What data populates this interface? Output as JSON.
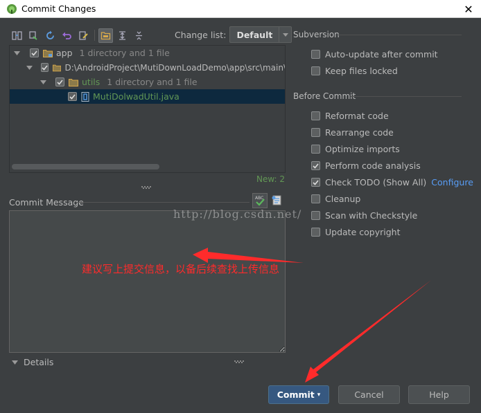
{
  "window": {
    "title": "Commit Changes"
  },
  "changelist": {
    "label": "Change list:",
    "value": "Default"
  },
  "tree": {
    "rows": [
      {
        "name": "app",
        "meta": "1 directory and 1 file"
      },
      {
        "name": "D:\\AndroidProject\\MutiDownLoadDemo\\app\\src\\main\\",
        "meta": ""
      },
      {
        "name": "utils",
        "meta": "1 directory and 1 file"
      },
      {
        "name": "MutiDolwadUtil.java",
        "meta": ""
      }
    ],
    "new_count": "New: 2"
  },
  "commit_message": {
    "label": "Commit Message",
    "value": ""
  },
  "details": {
    "label": "Details"
  },
  "subversion": {
    "title": "Subversion",
    "options": [
      {
        "label": "Auto-update after commit",
        "checked": false
      },
      {
        "label": "Keep files locked",
        "checked": false
      }
    ]
  },
  "before_commit": {
    "title": "Before Commit",
    "options": [
      {
        "label": "Reformat code",
        "checked": false
      },
      {
        "label": "Rearrange code",
        "checked": false
      },
      {
        "label": "Optimize imports",
        "checked": false
      },
      {
        "label": "Perform code analysis",
        "checked": true
      },
      {
        "label": "Check TODO (Show All)",
        "checked": true,
        "link": "Configure"
      },
      {
        "label": "Cleanup",
        "checked": false
      },
      {
        "label": "Scan with Checkstyle",
        "checked": false
      },
      {
        "label": "Update copyright",
        "checked": false
      }
    ]
  },
  "watermark": "http://blog.csdn.net/",
  "annotation": "建议写上提交信息，以备后续查找上传信息",
  "buttons": {
    "commit": "Commit",
    "cancel": "Cancel",
    "help": "Help"
  },
  "colors": {
    "background": "#3c3f41",
    "accent": "#365880",
    "annotation": "#ff2b2b",
    "link": "#589df6"
  }
}
